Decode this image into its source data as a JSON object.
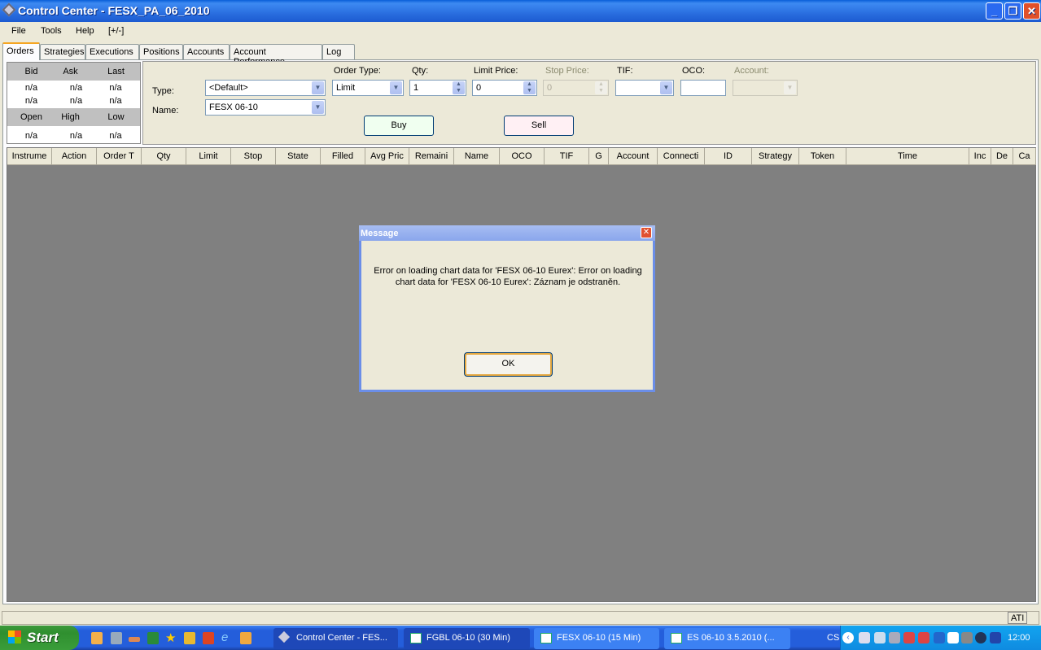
{
  "window": {
    "title": "Control Center - FESX_PA_06_2010"
  },
  "menu": [
    "File",
    "Tools",
    "Help",
    "[+/-]"
  ],
  "tabs": [
    "Orders",
    "Strategies",
    "Executions",
    "Positions",
    "Accounts",
    "Account Performance",
    "Log"
  ],
  "quote": {
    "headers1": [
      "Bid",
      "Ask",
      "Last"
    ],
    "row1": [
      "n/a",
      "n/a",
      "n/a"
    ],
    "row2": [
      "n/a",
      "n/a",
      "n/a"
    ],
    "headers2": [
      "Open",
      "High",
      "Low"
    ],
    "row3": [
      "n/a",
      "n/a",
      "n/a"
    ]
  },
  "entry": {
    "type_label": "Type:",
    "type_value": "<Default>",
    "name_label": "Name:",
    "name_value": "FESX 06-10",
    "order_type_label": "Order Type:",
    "order_type_value": "Limit",
    "qty_label": "Qty:",
    "qty_value": "1",
    "limit_label": "Limit Price:",
    "limit_value": "0",
    "stop_label": "Stop Price:",
    "stop_value": "0",
    "tif_label": "TIF:",
    "tif_value": "",
    "oco_label": "OCO:",
    "oco_value": "",
    "account_label": "Account:",
    "account_value": "",
    "buy": "Buy",
    "sell": "Sell",
    "buy_color": "#f0fff0",
    "sell_color": "#fff0f4"
  },
  "grid": {
    "columns": [
      "Instrume",
      "Action",
      "Order T",
      "Qty",
      "Limit",
      "Stop",
      "State",
      "Filled",
      "Avg Pric",
      "Remaini",
      "Name",
      "OCO",
      "TIF",
      "G",
      "Account",
      "Connecti",
      "ID",
      "Strategy",
      "Token",
      "Time",
      "Inc",
      "De",
      "Ca"
    ]
  },
  "status": {
    "ati": "ATI"
  },
  "dialog": {
    "title": "Message",
    "line1": "Error on loading chart data for 'FESX 06-10 Eurex': Error on loading",
    "line2": "chart data for 'FESX 06-10 Eurex': Záznam je odstraněn.",
    "ok": "OK"
  },
  "taskbar": {
    "start": "Start",
    "tasks": [
      "Control Center - FES...",
      "FGBL 06-10   (30 Min)",
      "FESX 06-10   (15 Min)",
      "ES 06-10  3.5.2010 (..."
    ],
    "lang": "CS",
    "clock": "12:00"
  }
}
